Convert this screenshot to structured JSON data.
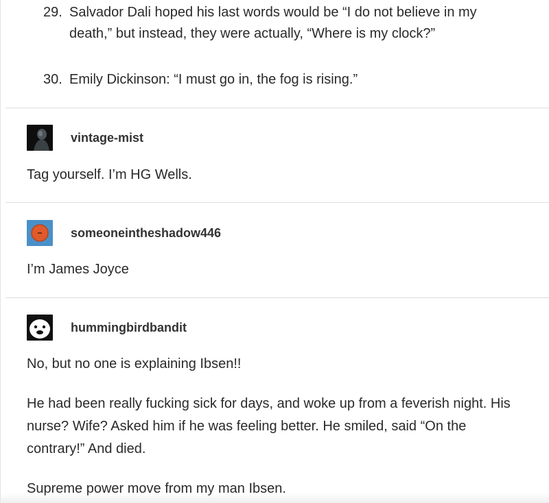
{
  "list_items": [
    {
      "number": "29.",
      "text": "Salvador Dali hoped his last words would be “I do not believe in my death,” but instead, they were actually, “Where is my clock?”"
    },
    {
      "number": "30.",
      "text": "Emily Dickinson: “I must go in, the fog is rising.”"
    }
  ],
  "replies": [
    {
      "username": "vintage-mist",
      "avatar_icon": "dark-silhouette-avatar",
      "paragraphs": [
        "Tag yourself. I’m HG Wells."
      ]
    },
    {
      "username": "someoneintheshadow446",
      "avatar_icon": "orange-circle-avatar",
      "paragraphs": [
        "I’m James Joyce"
      ]
    },
    {
      "username": "hummingbirdbandit",
      "avatar_icon": "cartoon-face-avatar",
      "paragraphs": [
        "No, but no one is explaining Ibsen!!",
        "He had been really fucking sick for days, and woke up from a feverish night. His nurse? Wife? Asked him if he was feeling better. He smiled, said “On the contrary!” And died.",
        "Supreme power move from my man Ibsen."
      ]
    }
  ],
  "colors": {
    "text": "#2a2a2a",
    "divider": "#dddddd",
    "avatar_blue": "#4a90c8",
    "avatar_orange": "#e05a2b"
  }
}
